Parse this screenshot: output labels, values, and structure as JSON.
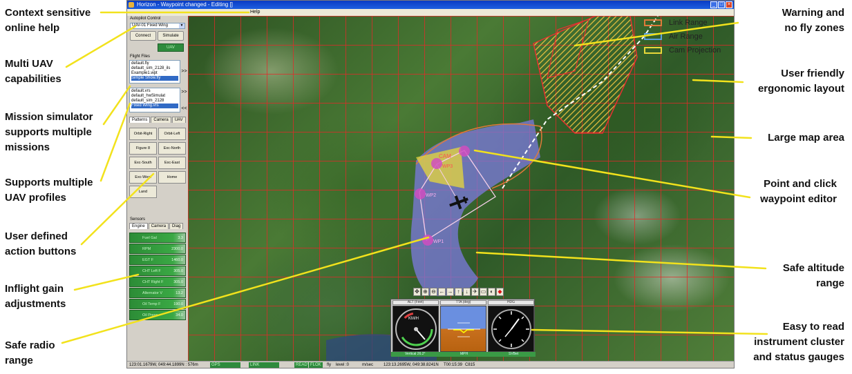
{
  "window": {
    "title": "Horizon - Waypoint changed - Editing []",
    "menu_help": "Help",
    "controls": {
      "minimize": "_",
      "maximize": "□",
      "close": "×"
    }
  },
  "callouts": {
    "left": [
      [
        "Context sensitive",
        "online help"
      ],
      [
        "Multi UAV",
        "capabilities"
      ],
      [
        "Mission simulator",
        "supports multiple",
        "missions"
      ],
      [
        "Supports multiple",
        "UAV profiles"
      ],
      [
        "User defined",
        "action buttons"
      ],
      [
        "Inflight gain",
        "adjustments"
      ],
      [
        "Safe radio",
        "range"
      ]
    ],
    "right": [
      [
        "Warning and",
        "no fly zones"
      ],
      [
        "User friendly",
        "ergonomic layout"
      ],
      [
        "Large map area"
      ],
      [
        "Point and click",
        "waypoint editor"
      ],
      [
        "Safe altitude",
        "range"
      ],
      [
        "Easy to read",
        "instrument cluster",
        "and status gauges"
      ]
    ]
  },
  "autopilot": {
    "group_label": "Autopilot Control",
    "uav_select": "UAV-01 Fixed Wing",
    "connect_label": "Connect",
    "simulate_label": "Simulate",
    "uav_label": "UAV"
  },
  "flight_files": {
    "group_label": "Flight Files",
    "files": [
      "default.fly",
      "default_sim_2128_ils",
      "Example1.wpt",
      "Simple Show.fly"
    ],
    "selected_file": 3,
    "profiles": [
      "default.vrs",
      "default_hwSimulat",
      "default_sim_2128",
      "Fixed Wing.vrs"
    ],
    "selected_profile": 3,
    "send_label": ">>",
    "send2_label": ">>",
    "back_label": "<<"
  },
  "pattern_tabs": [
    "Patterns",
    "Camera",
    "UAV"
  ],
  "patterns": [
    "Orbit-Right",
    "Orbit-Left",
    "Figure 8",
    "Exc-North",
    "Exc-South",
    "Exc-East",
    "Exc-West",
    "Home",
    "Land"
  ],
  "sensors": {
    "group_label": "Sensors",
    "tabs": [
      "Engine",
      "Camera",
      "Diag"
    ],
    "rows": [
      {
        "label": "Fuel Gal",
        "value": "3.3"
      },
      {
        "label": "RPM",
        "value": "2300.0"
      },
      {
        "label": "EGT F",
        "value": "1460.0"
      },
      {
        "label": "CHT Left F",
        "value": "305.0"
      },
      {
        "label": "CHT Right F",
        "value": "305.0"
      },
      {
        "label": "Alternator V",
        "value": "13.2"
      },
      {
        "label": "Oil Temp F",
        "value": "190.0"
      },
      {
        "label": "Oil Press",
        "value": "34.0"
      }
    ]
  },
  "legend": [
    {
      "label": "Link Range",
      "color": "#e07a3a"
    },
    {
      "label": "Air Range",
      "color": "#5aa0e0"
    },
    {
      "label": "Cam Projection",
      "color": "#e8d83a"
    }
  ],
  "waypoints": [
    "CAM",
    "WP3",
    "WP2",
    "WP1"
  ],
  "map_toolbar": [
    "✥",
    "⊕",
    "⊖",
    "←",
    "→",
    "↑",
    "↓",
    "✈",
    "▭",
    "◐",
    "◆"
  ],
  "instruments": {
    "heads": [
      "ALT (Feet)",
      "TTA (deg)",
      "HDG"
    ],
    "airspeed_unit": "KM/H",
    "footer_left": "Vertical 26.2°",
    "footer_mid": "MPH",
    "footer_right": "SVBet"
  },
  "status_bar": {
    "position": "123:01.1679W, 049:44.1899N :  576m",
    "gps": "GPS",
    "link": "LINK",
    "ready": "READY",
    "flok": "FLOK",
    "fly": "fly",
    "level": "level :0",
    "vspeed": "m/sec",
    "coords": "123:13.2695W, 049:38.8241N",
    "time": "T00:15:39",
    "ch": "C815"
  },
  "colors": {
    "grid": "#e62828",
    "no_fly_zone": "#e8c040",
    "lake": "#7a78d8",
    "waypoint": "#d04ec0",
    "instrument_green": "#2e8b3d"
  }
}
